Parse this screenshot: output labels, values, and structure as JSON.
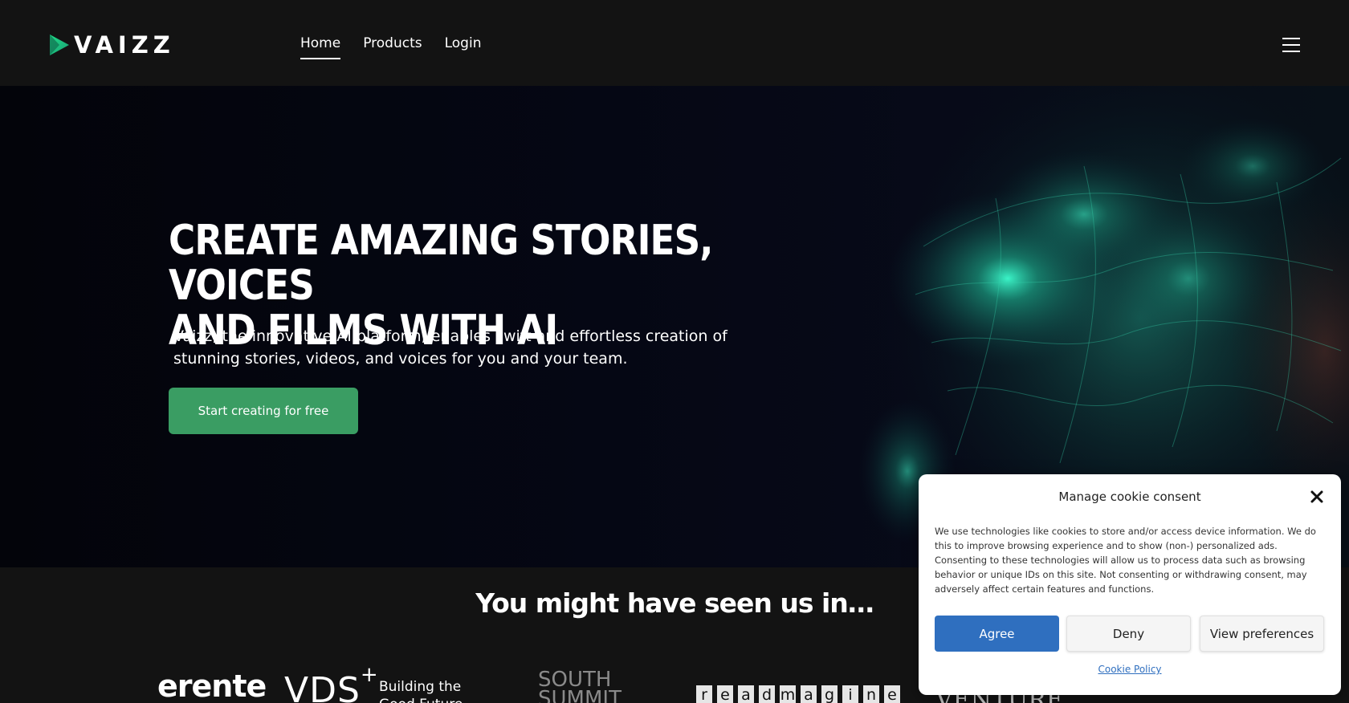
{
  "header": {
    "logo_text": "VAIZZ",
    "nav": [
      {
        "label": "Home",
        "active": true
      },
      {
        "label": "Products",
        "active": false
      },
      {
        "label": "Login",
        "active": false
      }
    ],
    "menu_icon": "hamburger-icon"
  },
  "hero": {
    "title_line1": "CREATE AMAZING STORIES, VOICES",
    "title_line2": "AND FILMS WITH AI",
    "subtitle_line1": "Vaizz, the innovative AI platform, enables swift and effortless creation of",
    "subtitle_line2": "stunning stories, videos, and voices for you and your team.",
    "cta_label": "Start creating for free",
    "accent_color": "#3a9d63"
  },
  "press": {
    "title": "You might have seen us in…",
    "logos": {
      "erente": "erente",
      "vds": "VDS",
      "vds_plus": "+",
      "building_line1": "Building the",
      "building_line2": "Good Future",
      "summit_line1": "SOUTH",
      "summit_line2": "SUMMIT",
      "readmagine": [
        "r",
        "e",
        "a",
        "d",
        "m",
        "a",
        "g",
        "i",
        "n",
        "e"
      ],
      "venture": "VENTURE"
    }
  },
  "cookie": {
    "title": "Manage cookie consent",
    "body": "We use technologies like cookies to store and/or access device information. We do this to improve browsing experience and to show (non-) personalized ads. Consenting to these technologies will allow us to process data such as browsing behavior or unique IDs on this site. Not consenting or withdrawing consent, may adversely affect certain features and functions.",
    "agree_label": "Agree",
    "deny_label": "Deny",
    "prefs_label": "View preferences",
    "policy_label": "Cookie Policy",
    "primary_color": "#2f6fbf"
  }
}
